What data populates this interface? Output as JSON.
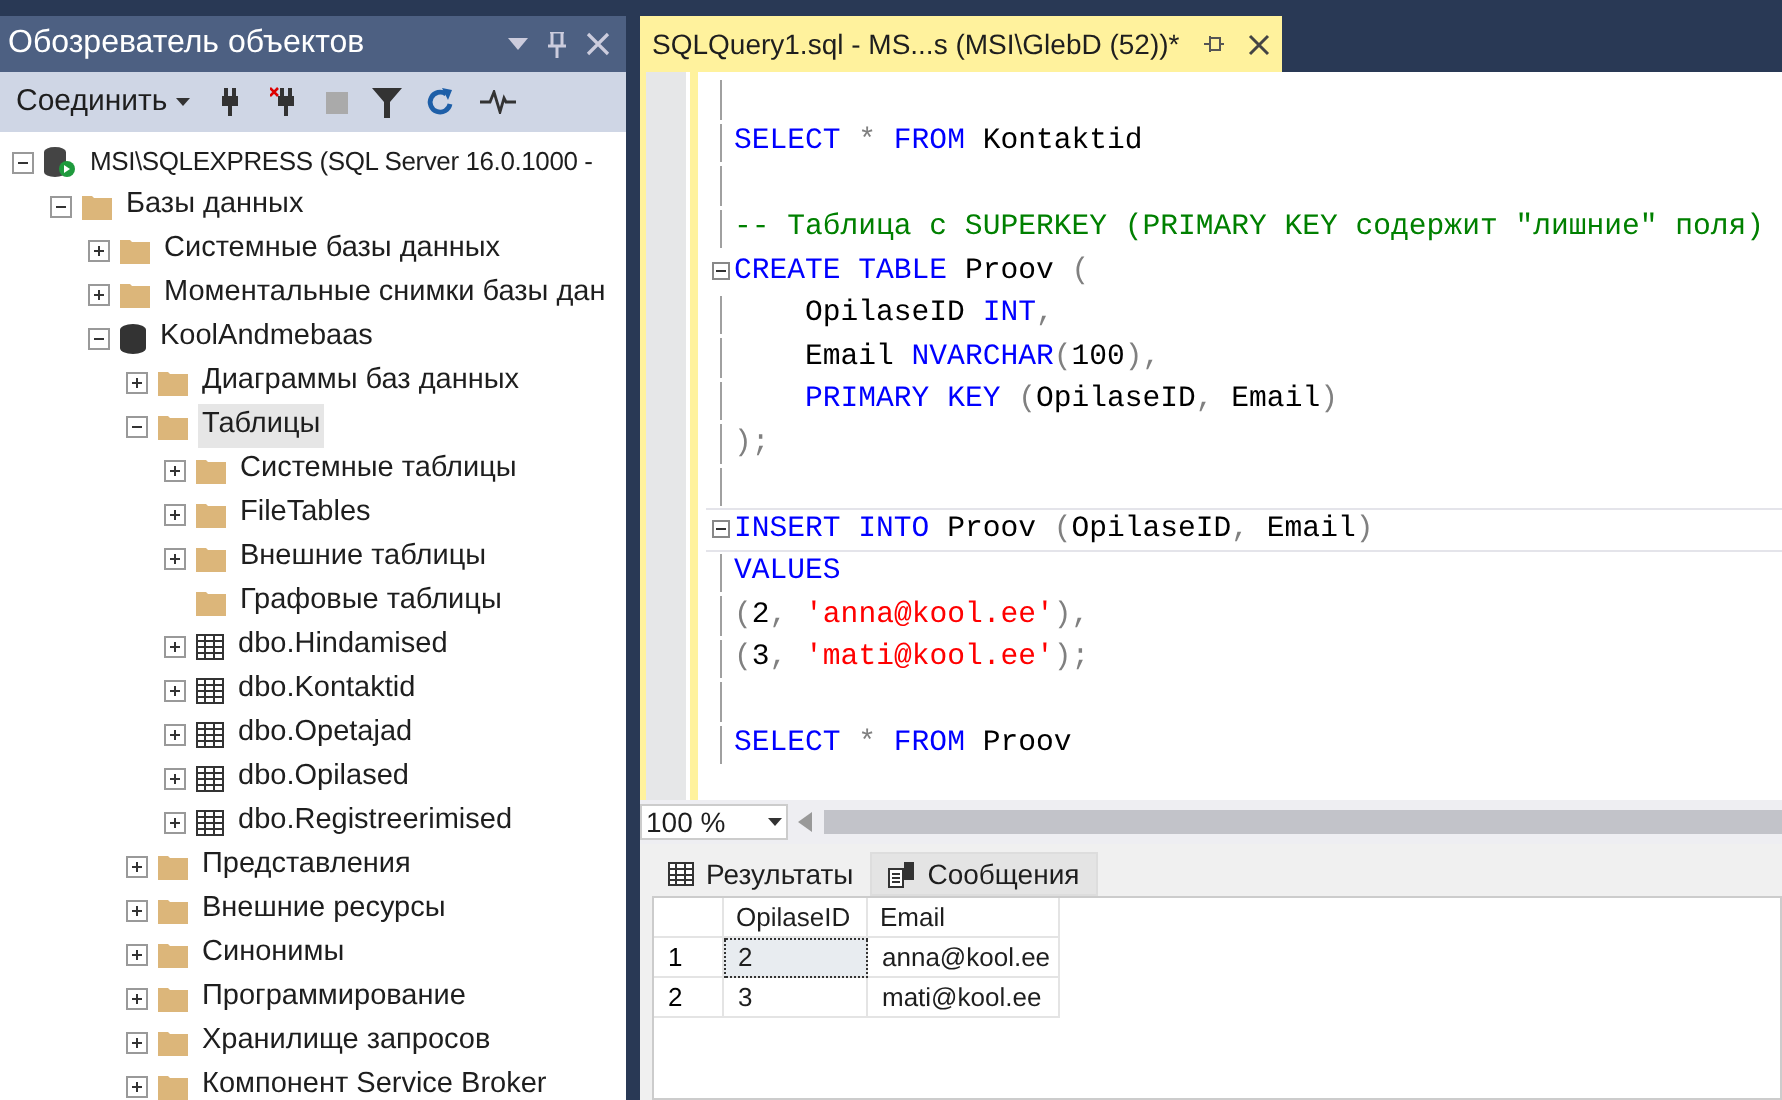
{
  "explorer": {
    "title": "Обозреватель объектов",
    "connect_label": "Соединить",
    "tree": [
      {
        "label": "MSI\\SQLEXPRESS (SQL Server 16.0.1000 -",
        "kind": "server",
        "expandable": true,
        "expanded": true,
        "selected": false,
        "children": [
          {
            "label": "Базы данных",
            "kind": "folder",
            "expandable": true,
            "expanded": true,
            "selected": false,
            "children": [
              {
                "label": "Системные базы данных",
                "kind": "folder",
                "expandable": true,
                "expanded": false,
                "selected": false
              },
              {
                "label": "Моментальные снимки базы дан",
                "kind": "folder",
                "expandable": true,
                "expanded": false,
                "selected": false
              },
              {
                "label": "KoolAndmebaas",
                "kind": "database",
                "expandable": true,
                "expanded": true,
                "selected": false,
                "children": [
                  {
                    "label": "Диаграммы баз данных",
                    "kind": "folder",
                    "expandable": true,
                    "expanded": false,
                    "selected": false
                  },
                  {
                    "label": "Таблицы",
                    "kind": "folder",
                    "expandable": true,
                    "expanded": true,
                    "selected": true,
                    "children": [
                      {
                        "label": "Системные таблицы",
                        "kind": "folder",
                        "expandable": true,
                        "expanded": false,
                        "selected": false
                      },
                      {
                        "label": "FileTables",
                        "kind": "folder",
                        "expandable": true,
                        "expanded": false,
                        "selected": false
                      },
                      {
                        "label": "Внешние таблицы",
                        "kind": "folder",
                        "expandable": true,
                        "expanded": false,
                        "selected": false
                      },
                      {
                        "label": "Графовые таблицы",
                        "kind": "folder",
                        "expandable": false,
                        "selected": false
                      },
                      {
                        "label": "dbo.Hindamised",
                        "kind": "table",
                        "expandable": true,
                        "expanded": false,
                        "selected": false
                      },
                      {
                        "label": "dbo.Kontaktid",
                        "kind": "table",
                        "expandable": true,
                        "expanded": false,
                        "selected": false
                      },
                      {
                        "label": "dbo.Opetajad",
                        "kind": "table",
                        "expandable": true,
                        "expanded": false,
                        "selected": false
                      },
                      {
                        "label": "dbo.Opilased",
                        "kind": "table",
                        "expandable": true,
                        "expanded": false,
                        "selected": false
                      },
                      {
                        "label": "dbo.Registreerimised",
                        "kind": "table",
                        "expandable": true,
                        "expanded": false,
                        "selected": false
                      }
                    ]
                  },
                  {
                    "label": "Представления",
                    "kind": "folder",
                    "expandable": true,
                    "expanded": false,
                    "selected": false
                  },
                  {
                    "label": "Внешние ресурсы",
                    "kind": "folder",
                    "expandable": true,
                    "expanded": false,
                    "selected": false
                  },
                  {
                    "label": "Синонимы",
                    "kind": "folder",
                    "expandable": true,
                    "expanded": false,
                    "selected": false
                  },
                  {
                    "label": "Программирование",
                    "kind": "folder",
                    "expandable": true,
                    "expanded": false,
                    "selected": false
                  },
                  {
                    "label": "Хранилище запросов",
                    "kind": "folder",
                    "expandable": true,
                    "expanded": false,
                    "selected": false
                  },
                  {
                    "label": "Компонент Service Broker",
                    "kind": "folder",
                    "expandable": true,
                    "expanded": false,
                    "selected": false
                  }
                ]
              }
            ]
          }
        ]
      }
    ]
  },
  "editor": {
    "tab_title": "SQLQuery1.sql - MS...s (MSI\\GlebD (52))*",
    "lines": [
      {
        "foldable": false,
        "current": false
      },
      {
        "foldable": false,
        "current": false,
        "tokens": [
          {
            "t": "SELECT",
            "kind": "keyword"
          },
          {
            "t": " *",
            "kind": "operator"
          },
          {
            "t": " FROM",
            "kind": "keyword"
          },
          {
            "t": " Kontaktid",
            "kind": "text"
          }
        ]
      },
      {
        "foldable": false,
        "current": false
      },
      {
        "foldable": false,
        "current": false,
        "tokens": [
          {
            "t": "-- Таблица с SUPERKEY (PRIMARY KEY содержит \"лишние\" поля)",
            "kind": "comment"
          }
        ]
      },
      {
        "foldable": true,
        "current": false,
        "tokens": [
          {
            "t": "CREATE",
            "kind": "keyword"
          },
          {
            "t": " TABLE",
            "kind": "keyword"
          },
          {
            "t": " Proov",
            "kind": "text"
          },
          {
            "t": " (",
            "kind": "operator"
          }
        ]
      },
      {
        "foldable": false,
        "current": false,
        "tokens": [
          {
            "t": "    OpilaseID",
            "kind": "text"
          },
          {
            "t": " INT",
            "kind": "keyword"
          },
          {
            "t": ",",
            "kind": "operator"
          }
        ]
      },
      {
        "foldable": false,
        "current": false,
        "tokens": [
          {
            "t": "    Email",
            "kind": "text"
          },
          {
            "t": " NVARCHAR",
            "kind": "keyword"
          },
          {
            "t": "(",
            "kind": "operator"
          },
          {
            "t": "100",
            "kind": "text"
          },
          {
            "t": "),",
            "kind": "operator"
          }
        ]
      },
      {
        "foldable": false,
        "current": false,
        "tokens": [
          {
            "t": "    PRIMARY",
            "kind": "keyword"
          },
          {
            "t": " KEY",
            "kind": "keyword"
          },
          {
            "t": " (",
            "kind": "operator"
          },
          {
            "t": "OpilaseID",
            "kind": "text"
          },
          {
            "t": ",",
            "kind": "operator"
          },
          {
            "t": " Email",
            "kind": "text"
          },
          {
            "t": ")",
            "kind": "operator"
          }
        ]
      },
      {
        "foldable": false,
        "current": false,
        "tokens": [
          {
            "t": ");",
            "kind": "operator"
          }
        ]
      },
      {
        "foldable": false,
        "current": false
      },
      {
        "foldable": true,
        "current": true,
        "tokens": [
          {
            "t": "INSERT",
            "kind": "keyword"
          },
          {
            "t": " INTO",
            "kind": "keyword"
          },
          {
            "t": " Proov",
            "kind": "text"
          },
          {
            "t": " (",
            "kind": "operator"
          },
          {
            "t": "OpilaseID",
            "kind": "text"
          },
          {
            "t": ",",
            "kind": "operator"
          },
          {
            "t": " Email",
            "kind": "text"
          },
          {
            "t": ")",
            "kind": "operator"
          }
        ]
      },
      {
        "foldable": false,
        "current": false,
        "tokens": [
          {
            "t": "VALUES",
            "kind": "keyword"
          }
        ]
      },
      {
        "foldable": false,
        "current": false,
        "tokens": [
          {
            "t": "(",
            "kind": "operator"
          },
          {
            "t": "2",
            "kind": "text"
          },
          {
            "t": ",",
            "kind": "operator"
          },
          {
            "t": " 'anna@kool.ee'",
            "kind": "string"
          },
          {
            "t": "),",
            "kind": "operator"
          }
        ]
      },
      {
        "foldable": false,
        "current": false,
        "tokens": [
          {
            "t": "(",
            "kind": "operator"
          },
          {
            "t": "3",
            "kind": "text"
          },
          {
            "t": ",",
            "kind": "operator"
          },
          {
            "t": " 'mati@kool.ee'",
            "kind": "string"
          },
          {
            "t": ");",
            "kind": "operator"
          }
        ]
      },
      {
        "foldable": false,
        "current": false
      },
      {
        "foldable": false,
        "current": false,
        "tokens": [
          {
            "t": "SELECT",
            "kind": "keyword"
          },
          {
            "t": " *",
            "kind": "operator"
          },
          {
            "t": " FROM",
            "kind": "keyword"
          },
          {
            "t": " Proov",
            "kind": "text"
          }
        ]
      }
    ],
    "zoom": "100 %"
  },
  "results": {
    "tabs": [
      {
        "label": "Результаты",
        "kind": "grid",
        "selected": true
      },
      {
        "label": "Сообщения",
        "kind": "messages",
        "selected": false
      }
    ],
    "columns": [
      "OpilaseID",
      "Email"
    ],
    "rows": [
      {
        "number": "1",
        "cells": [
          "2",
          "anna@kool.ee"
        ]
      },
      {
        "number": "2",
        "cells": [
          "3",
          "mati@kool.ee"
        ]
      }
    ]
  }
}
